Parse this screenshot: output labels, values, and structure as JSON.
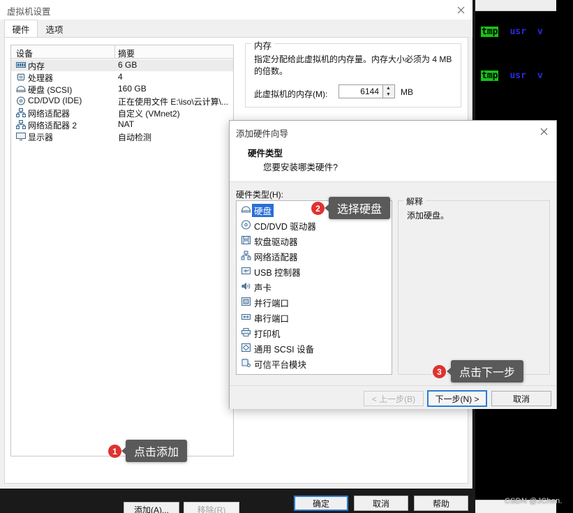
{
  "main_window": {
    "title": "虚拟机设置",
    "close_icon": "close-icon",
    "tabs": [
      {
        "label": "硬件",
        "active": true
      },
      {
        "label": "选项",
        "active": false
      }
    ],
    "device_table": {
      "headers": [
        "设备",
        "摘要"
      ],
      "rows": [
        {
          "icon": "memory-icon",
          "device": "内存",
          "summary": "6 GB",
          "selected": true
        },
        {
          "icon": "cpu-icon",
          "device": "处理器",
          "summary": "4",
          "selected": false
        },
        {
          "icon": "harddisk-icon",
          "device": "硬盘 (SCSI)",
          "summary": "160 GB",
          "selected": false
        },
        {
          "icon": "cddvd-icon",
          "device": "CD/DVD (IDE)",
          "summary": "正在使用文件 E:\\iso\\云计算\\...",
          "selected": false
        },
        {
          "icon": "network-icon",
          "device": "网络适配器",
          "summary": "自定义 (VMnet2)",
          "selected": false
        },
        {
          "icon": "network-icon",
          "device": "网络适配器 2",
          "summary": "NAT",
          "selected": false
        },
        {
          "icon": "display-icon",
          "device": "显示器",
          "summary": "自动检测",
          "selected": false
        }
      ]
    },
    "memory_panel": {
      "group_title": "内存",
      "description": "指定分配给此虚拟机的内存量。内存大小必须为 4 MB 的倍数。",
      "field_label": "此虚拟机的内存(M):",
      "value": "6144",
      "unit": "MB",
      "spin_up": "▲",
      "spin_down": "▼"
    },
    "buttons": {
      "add": "添加(A)...",
      "remove": "移除(R)",
      "ok": "确定",
      "cancel": "取消",
      "help": "帮助"
    }
  },
  "wizard": {
    "title": "添加硬件向导",
    "close_icon": "close-icon",
    "heading": "硬件类型",
    "subheading": "您要安装哪类硬件?",
    "list_label": "硬件类型(H):",
    "items": [
      {
        "icon": "harddisk-icon",
        "label": "硬盘",
        "selected": true
      },
      {
        "icon": "cddvd-icon",
        "label": "CD/DVD 驱动器",
        "selected": false
      },
      {
        "icon": "floppy-icon",
        "label": "软盘驱动器",
        "selected": false
      },
      {
        "icon": "network-icon",
        "label": "网络适配器",
        "selected": false
      },
      {
        "icon": "usb-icon",
        "label": "USB 控制器",
        "selected": false
      },
      {
        "icon": "sound-icon",
        "label": "声卡",
        "selected": false
      },
      {
        "icon": "parallel-icon",
        "label": "并行端口",
        "selected": false
      },
      {
        "icon": "serial-icon",
        "label": "串行端口",
        "selected": false
      },
      {
        "icon": "printer-icon",
        "label": "打印机",
        "selected": false
      },
      {
        "icon": "scsi-icon",
        "label": "通用 SCSI 设备",
        "selected": false
      },
      {
        "icon": "tpm-icon",
        "label": "可信平台模块",
        "selected": false
      }
    ],
    "explain": {
      "group_title": "解释",
      "text": "添加硬盘。"
    },
    "footer": {
      "back": "< 上一步(B)",
      "next": "下一步(N) >",
      "cancel": "取消"
    }
  },
  "annotations": [
    {
      "number": "1",
      "text": "点击添加"
    },
    {
      "number": "2",
      "text": "选择硬盘"
    },
    {
      "number": "3",
      "text": "点击下一步"
    }
  ],
  "terminal": {
    "lines": [
      {
        "tmp": "tmp",
        "usr": "usr",
        "v": "v"
      },
      {
        "tmp": "tmp",
        "usr": "usr",
        "v": "v"
      }
    ],
    "colors": {
      "tmp_bg": "#15c315",
      "usr_fg": "#2a2ae0",
      "bg": "#000000"
    }
  },
  "watermark": "CSDN @JChen."
}
